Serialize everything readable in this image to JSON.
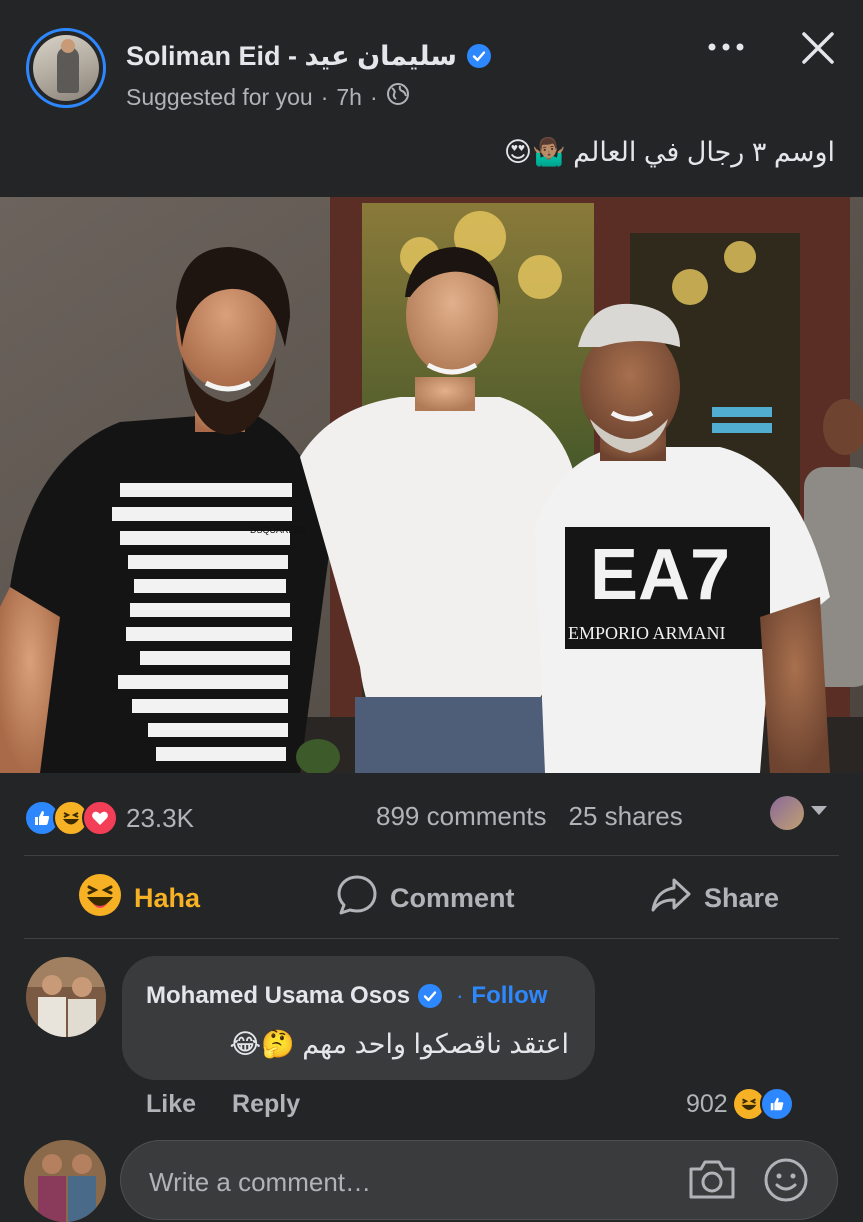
{
  "post": {
    "author_name": "Soliman Eid - سليمان عيد",
    "verified": true,
    "meta_suggested": "Suggested for you",
    "meta_time": "7h",
    "separator": "·",
    "text": "اوسم ٣ رجال في العالم 🤷🏽‍♂️😍",
    "photo": {
      "shirt_logos": [
        "DSQUARED2",
        "EA7",
        "EMPORIO ARMANI"
      ]
    }
  },
  "reactions": {
    "types": [
      "like-icon",
      "haha-icon",
      "love-icon"
    ],
    "count": "23.3K",
    "comments": "899 comments",
    "shares": "25 shares"
  },
  "actions": {
    "haha_label": "Haha",
    "comment_label": "Comment",
    "share_label": "Share"
  },
  "comment": {
    "author": "Mohamed Usama Osos",
    "verified": true,
    "follow_separator": "·",
    "follow_label": "Follow",
    "text": "اعتقد ناقصكوا واحد مهم 🤔😂",
    "like_label": "Like",
    "reply_label": "Reply",
    "reaction_count": "902"
  },
  "composer": {
    "placeholder": "Write a comment…"
  },
  "colors": {
    "background": "#242526",
    "accent": "#2d88ff",
    "haha_yellow": "#f7b125",
    "secondary_text": "#b0b3b8"
  }
}
